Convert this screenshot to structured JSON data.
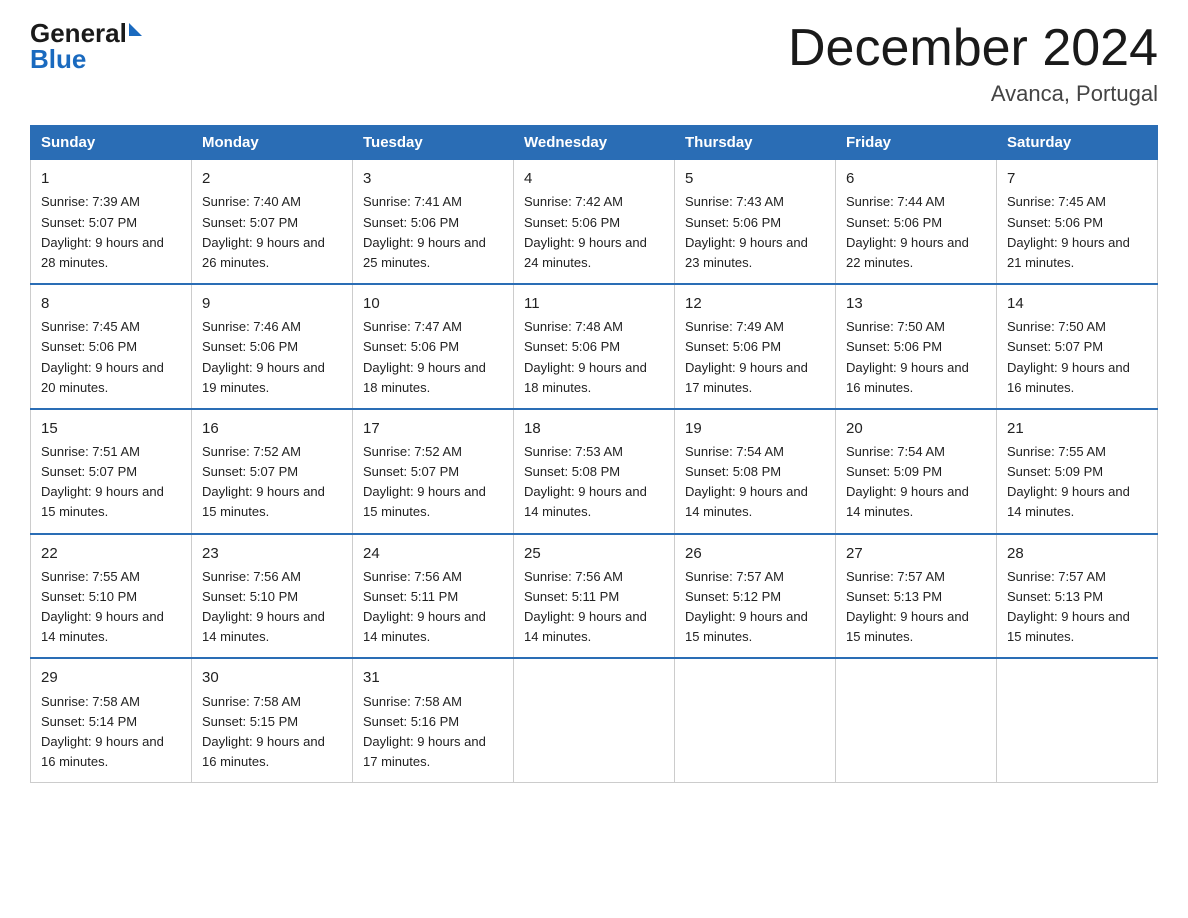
{
  "logo": {
    "general": "General",
    "blue": "Blue"
  },
  "title": "December 2024",
  "subtitle": "Avanca, Portugal",
  "days_of_week": [
    "Sunday",
    "Monday",
    "Tuesday",
    "Wednesday",
    "Thursday",
    "Friday",
    "Saturday"
  ],
  "weeks": [
    [
      {
        "day": "1",
        "sunrise": "7:39 AM",
        "sunset": "5:07 PM",
        "daylight": "9 hours and 28 minutes."
      },
      {
        "day": "2",
        "sunrise": "7:40 AM",
        "sunset": "5:07 PM",
        "daylight": "9 hours and 26 minutes."
      },
      {
        "day": "3",
        "sunrise": "7:41 AM",
        "sunset": "5:06 PM",
        "daylight": "9 hours and 25 minutes."
      },
      {
        "day": "4",
        "sunrise": "7:42 AM",
        "sunset": "5:06 PM",
        "daylight": "9 hours and 24 minutes."
      },
      {
        "day": "5",
        "sunrise": "7:43 AM",
        "sunset": "5:06 PM",
        "daylight": "9 hours and 23 minutes."
      },
      {
        "day": "6",
        "sunrise": "7:44 AM",
        "sunset": "5:06 PM",
        "daylight": "9 hours and 22 minutes."
      },
      {
        "day": "7",
        "sunrise": "7:45 AM",
        "sunset": "5:06 PM",
        "daylight": "9 hours and 21 minutes."
      }
    ],
    [
      {
        "day": "8",
        "sunrise": "7:45 AM",
        "sunset": "5:06 PM",
        "daylight": "9 hours and 20 minutes."
      },
      {
        "day": "9",
        "sunrise": "7:46 AM",
        "sunset": "5:06 PM",
        "daylight": "9 hours and 19 minutes."
      },
      {
        "day": "10",
        "sunrise": "7:47 AM",
        "sunset": "5:06 PM",
        "daylight": "9 hours and 18 minutes."
      },
      {
        "day": "11",
        "sunrise": "7:48 AM",
        "sunset": "5:06 PM",
        "daylight": "9 hours and 18 minutes."
      },
      {
        "day": "12",
        "sunrise": "7:49 AM",
        "sunset": "5:06 PM",
        "daylight": "9 hours and 17 minutes."
      },
      {
        "day": "13",
        "sunrise": "7:50 AM",
        "sunset": "5:06 PM",
        "daylight": "9 hours and 16 minutes."
      },
      {
        "day": "14",
        "sunrise": "7:50 AM",
        "sunset": "5:07 PM",
        "daylight": "9 hours and 16 minutes."
      }
    ],
    [
      {
        "day": "15",
        "sunrise": "7:51 AM",
        "sunset": "5:07 PM",
        "daylight": "9 hours and 15 minutes."
      },
      {
        "day": "16",
        "sunrise": "7:52 AM",
        "sunset": "5:07 PM",
        "daylight": "9 hours and 15 minutes."
      },
      {
        "day": "17",
        "sunrise": "7:52 AM",
        "sunset": "5:07 PM",
        "daylight": "9 hours and 15 minutes."
      },
      {
        "day": "18",
        "sunrise": "7:53 AM",
        "sunset": "5:08 PM",
        "daylight": "9 hours and 14 minutes."
      },
      {
        "day": "19",
        "sunrise": "7:54 AM",
        "sunset": "5:08 PM",
        "daylight": "9 hours and 14 minutes."
      },
      {
        "day": "20",
        "sunrise": "7:54 AM",
        "sunset": "5:09 PM",
        "daylight": "9 hours and 14 minutes."
      },
      {
        "day": "21",
        "sunrise": "7:55 AM",
        "sunset": "5:09 PM",
        "daylight": "9 hours and 14 minutes."
      }
    ],
    [
      {
        "day": "22",
        "sunrise": "7:55 AM",
        "sunset": "5:10 PM",
        "daylight": "9 hours and 14 minutes."
      },
      {
        "day": "23",
        "sunrise": "7:56 AM",
        "sunset": "5:10 PM",
        "daylight": "9 hours and 14 minutes."
      },
      {
        "day": "24",
        "sunrise": "7:56 AM",
        "sunset": "5:11 PM",
        "daylight": "9 hours and 14 minutes."
      },
      {
        "day": "25",
        "sunrise": "7:56 AM",
        "sunset": "5:11 PM",
        "daylight": "9 hours and 14 minutes."
      },
      {
        "day": "26",
        "sunrise": "7:57 AM",
        "sunset": "5:12 PM",
        "daylight": "9 hours and 15 minutes."
      },
      {
        "day": "27",
        "sunrise": "7:57 AM",
        "sunset": "5:13 PM",
        "daylight": "9 hours and 15 minutes."
      },
      {
        "day": "28",
        "sunrise": "7:57 AM",
        "sunset": "5:13 PM",
        "daylight": "9 hours and 15 minutes."
      }
    ],
    [
      {
        "day": "29",
        "sunrise": "7:58 AM",
        "sunset": "5:14 PM",
        "daylight": "9 hours and 16 minutes."
      },
      {
        "day": "30",
        "sunrise": "7:58 AM",
        "sunset": "5:15 PM",
        "daylight": "9 hours and 16 minutes."
      },
      {
        "day": "31",
        "sunrise": "7:58 AM",
        "sunset": "5:16 PM",
        "daylight": "9 hours and 17 minutes."
      },
      null,
      null,
      null,
      null
    ]
  ]
}
